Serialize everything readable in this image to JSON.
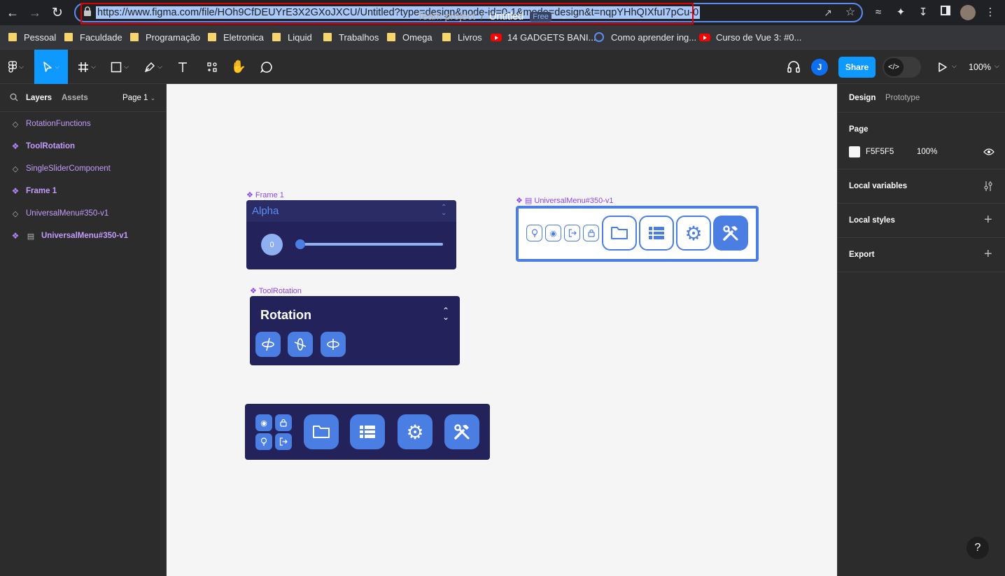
{
  "browser": {
    "url": "https://www.figma.com/file/HOh9CfDEUYrE3X2GXoJXCU/Untitled?type=design&node-id=0-1&mode=design&t=nqpYHhQIXfuI7pCu-0",
    "bookmarks": [
      {
        "label": "Pessoal",
        "icon": "folder-icon"
      },
      {
        "label": "Faculdade",
        "icon": "folder-icon"
      },
      {
        "label": "Programação",
        "icon": "folder-icon"
      },
      {
        "label": "Eletronica",
        "icon": "folder-icon"
      },
      {
        "label": "Liquid",
        "icon": "folder-icon"
      },
      {
        "label": "Trabalhos",
        "icon": "folder-icon"
      },
      {
        "label": "Omega",
        "icon": "folder-icon"
      },
      {
        "label": "Livros",
        "icon": "folder-icon"
      },
      {
        "label": "14 GADGETS BANI...",
        "icon": "youtube-icon"
      },
      {
        "label": "Como aprender ing...",
        "icon": "globe-icon"
      },
      {
        "label": "Curso de Vue 3: #0...",
        "icon": "youtube-icon"
      }
    ]
  },
  "toolbar": {
    "project": "Team project",
    "separator": "/",
    "file_name": "Untitled",
    "plan_badge": "Free",
    "share_label": "Share",
    "avatar_initial": "J",
    "zoom": "100%"
  },
  "left_panel": {
    "tabs": {
      "layers": "Layers",
      "assets": "Assets",
      "page": "Page 1"
    },
    "layers": [
      {
        "name": "RotationFunctions",
        "icon": "component-outline-icon",
        "bold": false
      },
      {
        "name": "ToolRotation",
        "icon": "component-icon",
        "bold": true
      },
      {
        "name": "SingleSliderComponent",
        "icon": "component-outline-icon",
        "bold": false
      },
      {
        "name": "Frame 1",
        "icon": "component-icon",
        "bold": true
      },
      {
        "name": "UniversalMenu#350-v1",
        "icon": "component-outline-icon",
        "bold": false
      },
      {
        "name": "UniversalMenu#350-v1",
        "icon": "component-icon",
        "bold": true
      }
    ]
  },
  "canvas": {
    "frame1": {
      "label": "Frame 1",
      "title": "Alpha",
      "slider_value": "0",
      "slider_level": 0
    },
    "tool_rotation": {
      "label": "ToolRotation",
      "title": "Rotation"
    },
    "universal_menu": {
      "label": "UniversalMenu#350-v1"
    }
  },
  "right_panel": {
    "tabs": {
      "design": "Design",
      "prototype": "Prototype"
    },
    "page_title": "Page",
    "page_color": "F5F5F5",
    "page_opacity": "100%",
    "local_variables": "Local variables",
    "local_styles": "Local styles",
    "export": "Export"
  },
  "help": "?",
  "colors": {
    "figma_blue": "#0d99ff",
    "component_purple": "#8b48f0",
    "navy": "#23225b",
    "accent_blue": "#4a7ee3"
  }
}
